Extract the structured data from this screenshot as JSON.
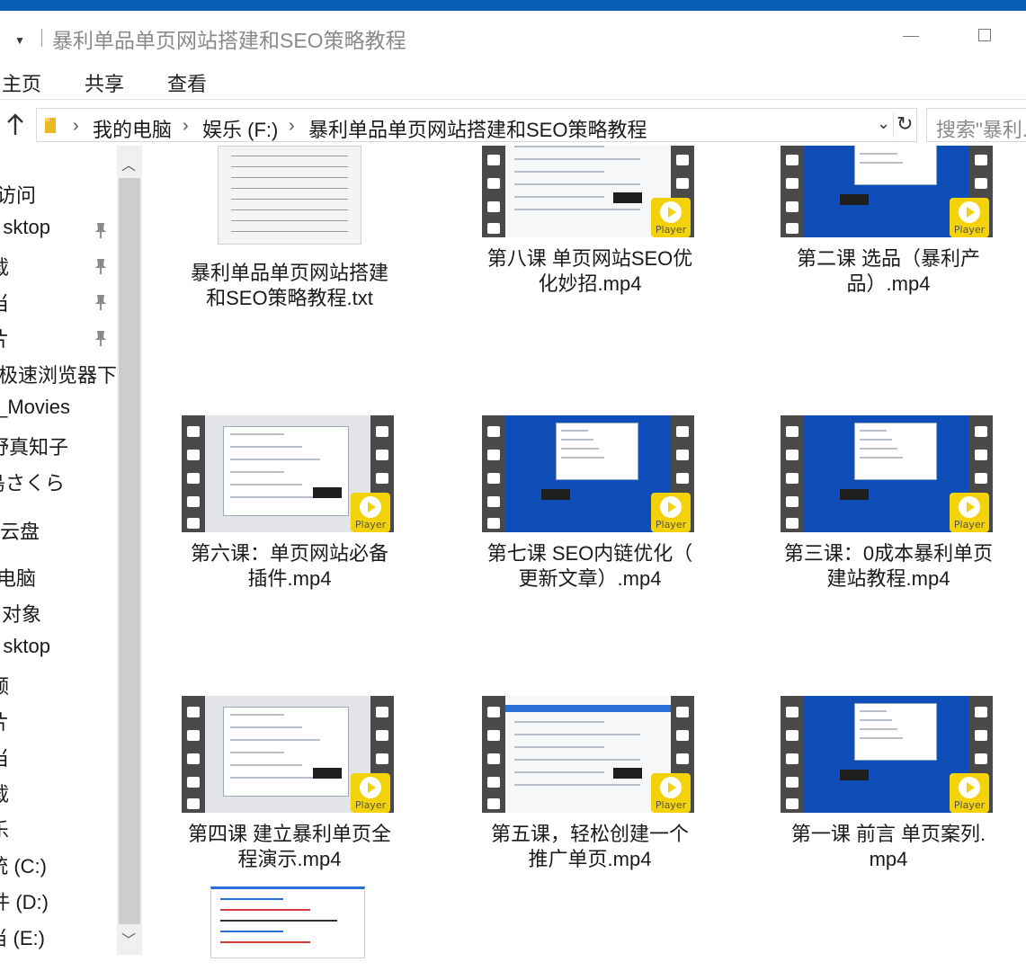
{
  "window": {
    "title": "暴利单品单页网站搭建和SEO策略教程"
  },
  "ribbon": {
    "tabs": [
      "主页",
      "共享",
      "查看"
    ]
  },
  "address": {
    "crumbs": [
      "我的电脑",
      "娱乐 (F:)",
      "暴利单品单页网站搭建和SEO策略教程"
    ],
    "search_placeholder": "搜索\"暴利..."
  },
  "nav": {
    "items": [
      {
        "label": "访问",
        "pinned": false
      },
      {
        "label": "sktop",
        "pinned": true
      },
      {
        "label": "载",
        "pinned": true
      },
      {
        "label": "当",
        "pinned": true
      },
      {
        "label": "片",
        "pinned": true
      },
      {
        "label": "e极速浏览器下",
        "pinned": false
      },
      {
        "label": "_Movies",
        "pinned": false
      },
      {
        "label": "野真知子",
        "pinned": false
      },
      {
        "label": "島さくら",
        "pinned": false
      },
      {
        "label": "云盘",
        "pinned": false
      },
      {
        "label": "电脑",
        "pinned": false
      },
      {
        "label": "对象",
        "pinned": false
      },
      {
        "label": "sktop",
        "pinned": false
      },
      {
        "label": "频",
        "pinned": false
      },
      {
        "label": "片",
        "pinned": false
      },
      {
        "label": "当",
        "pinned": false
      },
      {
        "label": "载",
        "pinned": false
      },
      {
        "label": "乐",
        "pinned": false
      },
      {
        "label": "统 (C:)",
        "pinned": false
      },
      {
        "label": "件 (D:)",
        "pinned": false
      },
      {
        "label": "当 (E:)",
        "pinned": false
      }
    ]
  },
  "files": [
    {
      "line1": "暴利单品单页网站搭建",
      "line2": "和SEO策略教程.txt",
      "kind": "txt"
    },
    {
      "line1": "第八课 单页网站SEO优",
      "line2": "化妙招.mp4",
      "kind": "video",
      "screen": "white"
    },
    {
      "line1": "第二课 选品（暴利产",
      "line2": "品）.mp4",
      "kind": "video",
      "screen": "blue"
    },
    {
      "line1": "第六课：单页网站必备",
      "line2": "插件.mp4",
      "kind": "video",
      "screen": "gray"
    },
    {
      "line1": "第七课 SEO内链优化（",
      "line2": "更新文章）.mp4",
      "kind": "video",
      "screen": "blue"
    },
    {
      "line1": "第三课：0成本暴利单页",
      "line2": "建站教程.mp4",
      "kind": "video",
      "screen": "blue"
    },
    {
      "line1": "第四课 建立暴利单页全",
      "line2": "程演示.mp4",
      "kind": "video",
      "screen": "gray"
    },
    {
      "line1": "第五课，轻松创建一个",
      "line2": "推广单页.mp4",
      "kind": "video",
      "screen": "white"
    },
    {
      "line1": "第一课 前言 单页案列.",
      "line2": "mp4",
      "kind": "video",
      "screen": "blue"
    }
  ],
  "player_badge_text": "Player",
  "colors": {
    "accent": "#0a5fb4",
    "player_badge": "#f4d20a",
    "video_blue": "#0f4db8",
    "film_strip": "#4a4a4a"
  },
  "icons": [
    "up-arrow-icon",
    "folder-icon",
    "chevron-right-icon",
    "dropdown-icon",
    "refresh-icon",
    "pin-icon",
    "scroll-up-icon",
    "scroll-down-icon",
    "play-icon"
  ]
}
